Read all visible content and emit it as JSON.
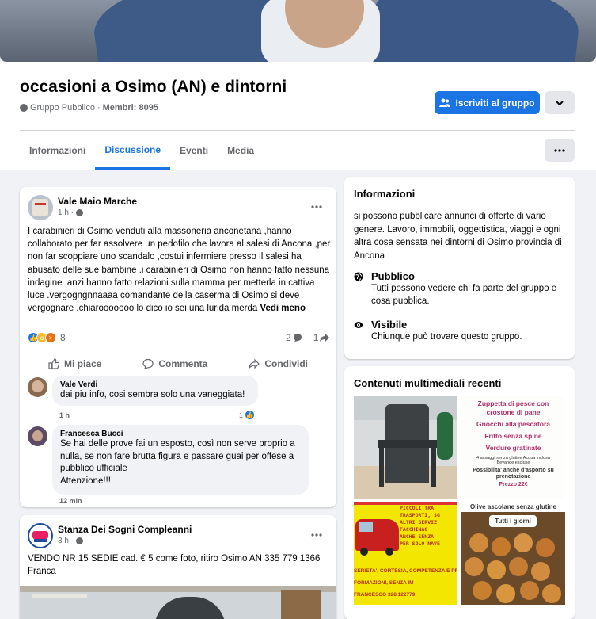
{
  "group": {
    "name": "occasioni a Osimo (AN) e dintorni",
    "privacy": "Gruppo Pubblico",
    "separator": "·",
    "members_label": "Membri: 8095",
    "join_label": "Iscriviti al gruppo"
  },
  "tabs": [
    {
      "label": "Informazioni"
    },
    {
      "label": "Discussione"
    },
    {
      "label": "Eventi"
    },
    {
      "label": "Media"
    }
  ],
  "post1": {
    "author": "Vale Maio Marche",
    "time": "1 h ·",
    "text": "I carabinieri  di Osimo venduti alla massoneria anconetana ,hanno collaborato per far assolvere un pedofilo che lavora al salesi di Ancona ,per non far scoppiare uno scandalo ,costui infermiere presso il salesi ha abusato delle sue bambine .i carabinieri di Osimo non hanno fatto nessuna indagine ,anzi hanno fatto relazioni sulla mamma per metterla in cattiva luce .vergogngnnaaaa comandante della caserma di Osimo si deve vergognare .chiarooooooo lo dico io sei una lurida merda",
    "see_less": "Vedi meno",
    "reaction_count": "8",
    "comments_count": "2",
    "shares_count": "1",
    "like_label": "Mi piace",
    "comment_label": "Commenta",
    "share_label": "Condividi",
    "comments": [
      {
        "author": "Vale Verdi",
        "text": "dai piu info, cosi sembra solo una vaneggiata!",
        "time": "1 h",
        "likes": "1"
      },
      {
        "author": "Francesca Bucci",
        "text": "Se hai delle prove fai un esposto, così non serve proprio a nulla, se non fare brutta figura e passare guai per offese a pubblico ufficiale\nAttenzione!!!!",
        "time": "12 min"
      }
    ]
  },
  "post2": {
    "author": "Stanza Dei Sogni Compleanni",
    "time": "3 h ·",
    "text": "VENDO NR 15 SEDIE cad. € 5 come foto, ritiro Osimo AN 335 779 1366 Franca"
  },
  "info": {
    "title": "Informazioni",
    "description": "si possono pubblicare annunci di offerte di vario genere. Lavoro, immobili, oggettistica, viaggi e ogni altra cosa sensata nei dintorni di Osimo provincia di Ancona",
    "public_title": "Pubblico",
    "public_text": "Tutti possono vedere chi fa parte del gruppo e cosa pubblica.",
    "visible_title": "Visibile",
    "visible_text": "Chiunque può trovare questo gruppo."
  },
  "media": {
    "title": "Contenuti multimediali recenti",
    "menu": {
      "line1": "Zuppetta di pesce con crostone di pane",
      "line2": "Gnocchi alla pescatora",
      "line3": "Fritto senza spine",
      "line4": "Verdure gratinate",
      "small1": "4 assaggi senza glutine Acqua inclusa",
      "small2": "Bevande escluse",
      "takeaway": "Possibilita' anche d'asporto su prenotazione",
      "price": "Prezzo 22€"
    },
    "van": {
      "line1": "PICCOLI TRA",
      "line2": "TRASPORTI, SG",
      "line3": "ALTRI SERVIZ",
      "line4": "FACCHINAG",
      "line5": "ANCHE SENZA",
      "line6": "PER SOLO NAVE",
      "line7": "SERIETA', CORTESIA, COMPETENZA E PR",
      "line8": "FORMAZIONI, SENZA IM",
      "line9": "FRANCESCO 328.122779"
    },
    "olives": {
      "label1": "Olive ascolane senza glutine",
      "label2": "Tutti i giorni"
    }
  },
  "colors": {
    "accent": "#1b74e4",
    "background": "#f0f2f5",
    "secondary_text": "#65676b"
  }
}
